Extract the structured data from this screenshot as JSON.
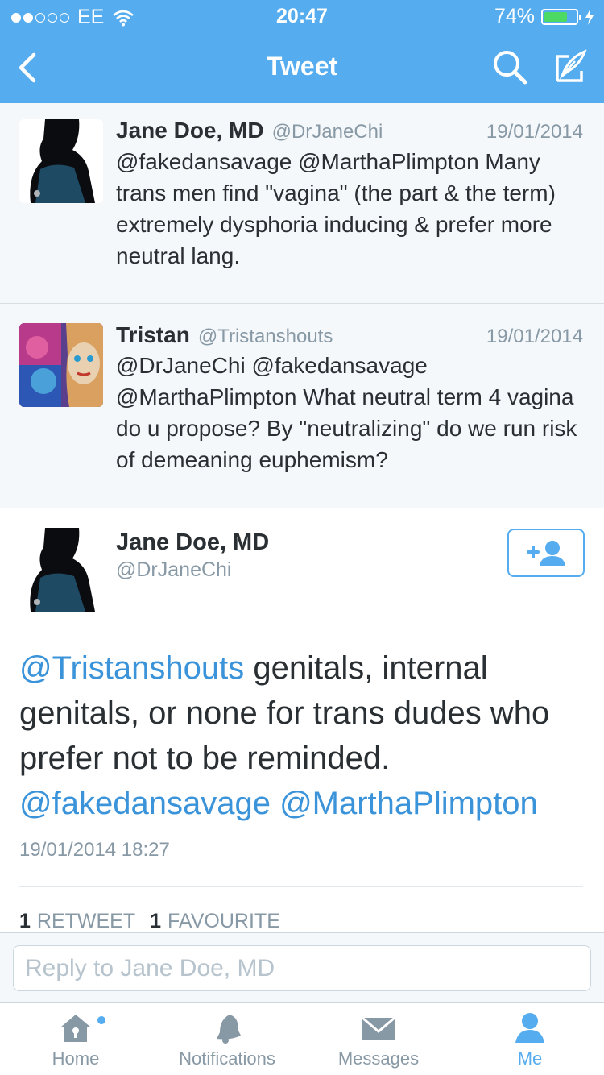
{
  "status_bar": {
    "carrier": "EE",
    "time": "20:47",
    "battery_percent": "74%",
    "battery_level": 0.74,
    "signal_bars_filled": 2,
    "signal_bars_total": 5
  },
  "nav": {
    "title": "Tweet",
    "back_icon": "chevron-left-icon",
    "search_icon": "search-icon",
    "compose_icon": "compose-quill-icon"
  },
  "tweets": [
    {
      "name": "Jane Doe, MD",
      "handle": "@DrJaneChi",
      "date": "19/01/2014",
      "text": "@fakedansavage @MarthaPlimpton Many trans men find \"vagina\" (the part & the term) extremely dysphoria inducing & prefer more neutral lang."
    },
    {
      "name": "Tristan",
      "handle": "@Tristanshouts",
      "date": "19/01/2014",
      "text": "@DrJaneChi @fakedansavage @MarthaPlimpton What neutral term 4 vagina do u propose? By \"neutralizing\" do we run risk of demeaning euphemism?"
    }
  ],
  "main_tweet": {
    "name": "Jane Doe, MD",
    "handle": "@DrJaneChi",
    "mention_1": "@Tristanshouts",
    "body": " genitals, internal genitals, or none for trans dudes who prefer not to be reminded. ",
    "mention_2": "@fakedansavage",
    "mention_3": "@MarthaPlimpton",
    "timestamp": "19/01/2014 18:27",
    "retweet_count": "1",
    "retweet_label": "RETWEET",
    "favourite_count": "1",
    "favourite_label": "FAVOURITE",
    "follow_icon": "add-user-icon"
  },
  "reply": {
    "placeholder": "Reply to Jane Doe, MD"
  },
  "tabs": [
    {
      "label": "Home",
      "icon": "home-icon",
      "active": false,
      "has_notification_dot": true
    },
    {
      "label": "Notifications",
      "icon": "bell-icon",
      "active": false
    },
    {
      "label": "Messages",
      "icon": "envelope-icon",
      "active": false
    },
    {
      "label": "Me",
      "icon": "person-icon",
      "active": true
    }
  ],
  "colors": {
    "brand_blue": "#55acee",
    "mention_blue": "#3b94d9",
    "text_dark": "#292f33",
    "text_grey": "#8899a6",
    "row_bg": "#f5f8fa",
    "battery_green": "#4cd964"
  }
}
